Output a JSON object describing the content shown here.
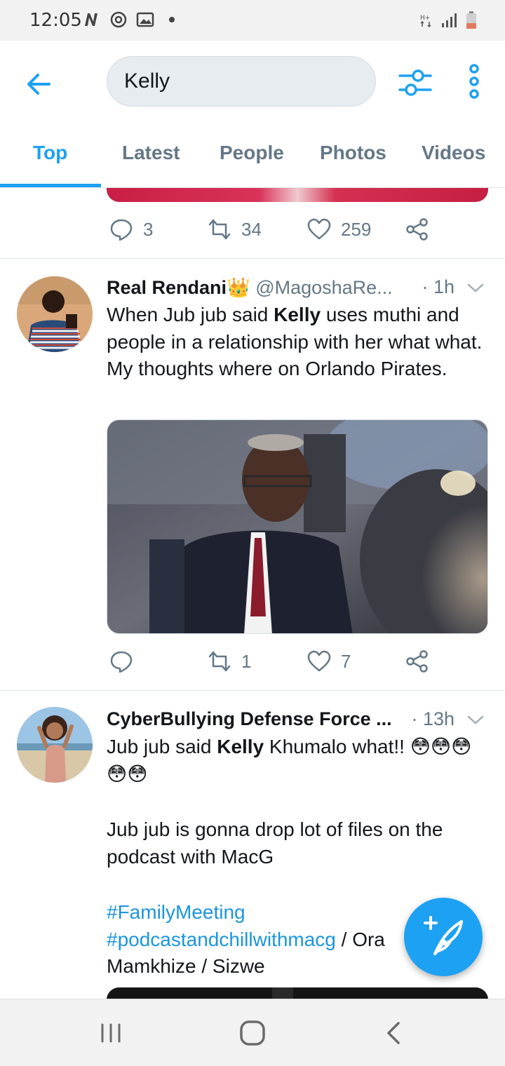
{
  "status_bar": {
    "time": "12:05",
    "left_icons": [
      "netflix-n-icon",
      "sync-icon",
      "gallery-icon",
      "dot-icon"
    ],
    "right_icons": [
      "hplus-icon",
      "signal-icon",
      "battery-icon"
    ]
  },
  "header": {
    "back_icon": "arrow-left-icon",
    "search_value": "Kelly",
    "filter_icon": "sliders-icon",
    "more_icon": "more-vertical-icon"
  },
  "tabs": [
    {
      "label": "Top",
      "active": true
    },
    {
      "label": "Latest",
      "active": false
    },
    {
      "label": "People",
      "active": false
    },
    {
      "label": "Photos",
      "active": false
    },
    {
      "label": "Videos",
      "active": false
    }
  ],
  "prev_tweet": {
    "replies": "3",
    "retweets": "34",
    "likes": "259"
  },
  "tweets": [
    {
      "name": "Real Rendani👑",
      "handle": "@MagoshaRe...",
      "time": "· 1h",
      "text_before": "When Jub jub said ",
      "text_bold": "Kelly",
      "text_after": " uses muthi and people in a relationship with her what what. My thoughts where on Orlando Pirates.",
      "replies": "",
      "retweets": "1",
      "likes": "7"
    },
    {
      "name": "CyberBullying Defense Force ...",
      "time": "· 13h",
      "line1_before": "Jub jub said ",
      "line1_bold": "Kelly",
      "line1_after": " Khumalo what!! 😳😳😳😳😳",
      "line2": "Jub jub is gonna drop lot of files on the podcast with MacG",
      "hashtag1": "#FamilyMeeting",
      "hashtag2": "#podcastandchillwithmacg",
      "line3_after": " / Ora",
      "line4": "Mamkhize / Sizwe"
    }
  ],
  "fab_icon": "compose-feather-icon",
  "colors": {
    "accent": "#1da1f2",
    "muted": "#657786",
    "text": "#14171a"
  }
}
